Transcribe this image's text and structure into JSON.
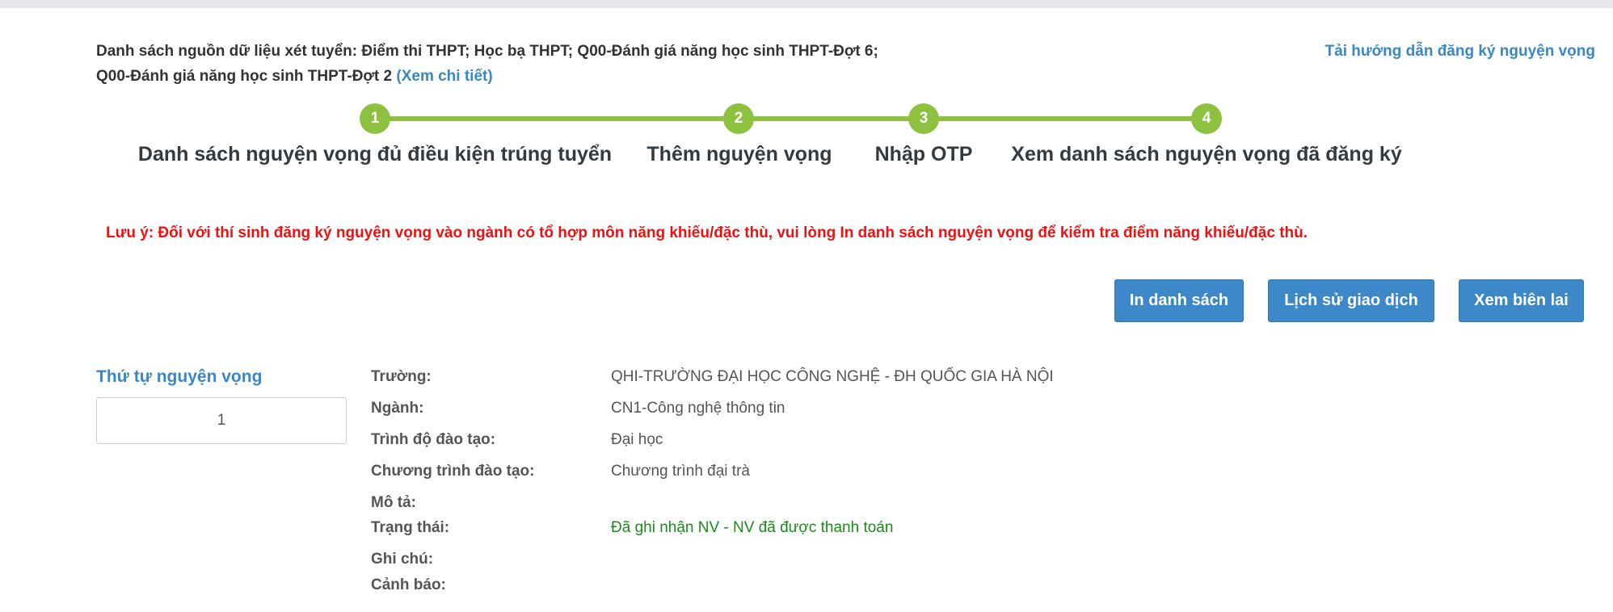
{
  "header": {
    "data_sources_text": "Danh sách nguồn dữ liệu xét tuyển: Điểm thi THPT; Học bạ THPT; Q00-Đánh giá năng học sinh THPT-Đợt 6; Q00-Đánh giá năng học sinh THPT-Đợt 2",
    "detail_link": "(Xem chi tiết)",
    "guide_link": "Tải hướng dẫn đăng ký nguyện vọng"
  },
  "steps": [
    {
      "number": "1",
      "label": "Danh sách nguyện vọng đủ điều kiện trúng tuyển"
    },
    {
      "number": "2",
      "label": "Thêm nguyện vọng"
    },
    {
      "number": "3",
      "label": "Nhập OTP"
    },
    {
      "number": "4",
      "label": "Xem danh sách nguyện vọng đã đăng ký"
    }
  ],
  "note": "Lưu ý: Đối với thí sinh đăng ký nguyện vọng vào ngành có tổ hợp môn năng khiếu/đặc thù, vui lòng In danh sách nguyện vọng để kiểm tra điểm năng khiếu/đặc thù.",
  "buttons": {
    "print": "In danh sách",
    "history": "Lịch sử giao dịch",
    "receipt": "Xem biên lai"
  },
  "wish": {
    "order_label": "Thứ tự nguyện vọng",
    "order_value": "1",
    "fields": [
      {
        "label": "Trường:",
        "value": "QHI-TRƯỜNG ĐẠI HỌC CÔNG NGHỆ - ĐH QUỐC GIA HÀ NỘI"
      },
      {
        "label": "Ngành:",
        "value": "CN1-Công nghệ thông tin"
      },
      {
        "label": "Trình độ đào tạo:",
        "value": "Đại học"
      },
      {
        "label": "Chương trình đào tạo:",
        "value": "Chương trình đại trà"
      },
      {
        "label": "Mô tả:",
        "value": ""
      },
      {
        "label": "Trạng thái:",
        "value": "Đã ghi nhận NV - NV đã được thanh toán"
      },
      {
        "label": "Ghi chú:",
        "value": ""
      },
      {
        "label": "Cảnh báo:",
        "value": ""
      }
    ]
  },
  "colors": {
    "accent_blue": "#3a87c8",
    "step_green": "#8dc13f",
    "warning_red": "#ee1111",
    "status_green": "#1a8a1a"
  }
}
